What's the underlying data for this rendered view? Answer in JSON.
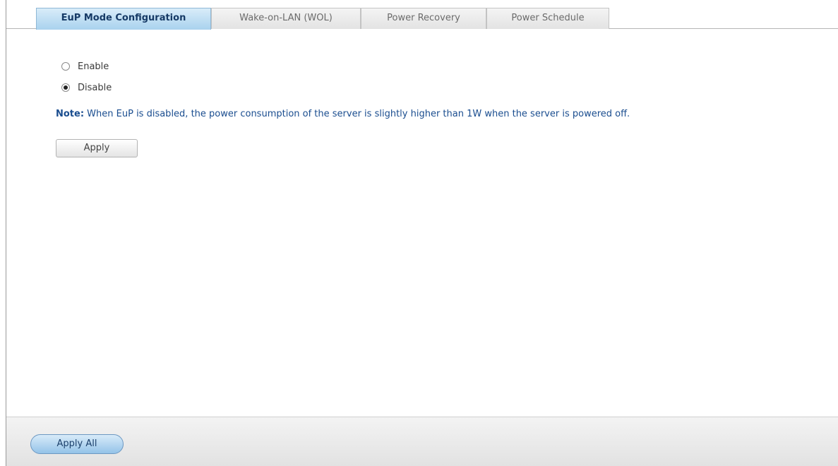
{
  "tabs": [
    {
      "label": "EuP Mode Configuration",
      "active": true
    },
    {
      "label": "Wake-on-LAN (WOL)",
      "active": false
    },
    {
      "label": "Power Recovery",
      "active": false
    },
    {
      "label": "Power Schedule",
      "active": false
    }
  ],
  "eup": {
    "options": [
      {
        "label": "Enable",
        "checked": false
      },
      {
        "label": "Disable",
        "checked": true
      }
    ],
    "note_prefix": "Note:",
    "note_text": " When EuP is disabled, the power consumption of the server is slightly higher than 1W when the server is powered off.",
    "apply_label": "Apply"
  },
  "footer": {
    "apply_all_label": "Apply All"
  },
  "colors": {
    "active_tab": "#a9d2ee",
    "note_text": "#1a4d8f",
    "apply_all": "#94c3e8"
  }
}
